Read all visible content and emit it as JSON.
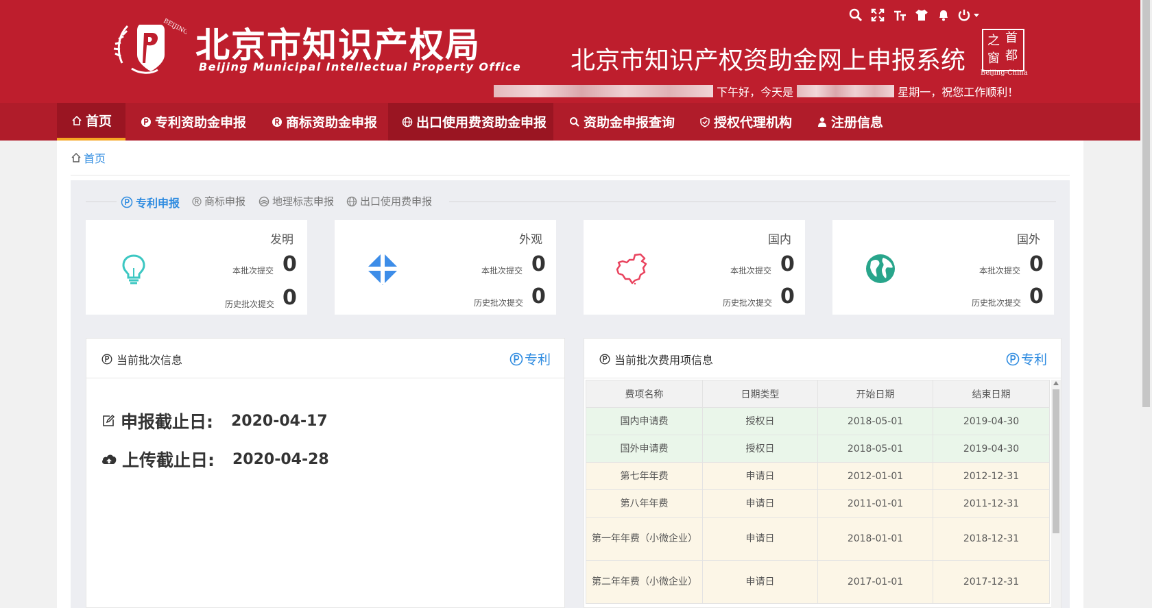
{
  "header": {
    "org_cn": "北京市知识产权局",
    "org_en": "Beijing Municipal Intellectual Property Office",
    "seal_text": "BEIJING INTELLECTUAL PROPERTY",
    "system_title": "北京市知识产权资助金网上申报系统",
    "badge_chars": [
      "之",
      "首",
      "窗",
      "都"
    ],
    "badge_en": "Beijing-China",
    "greeting_1": "下午好，今天是",
    "greeting_2": "星期一，祝您工作顺利！",
    "icons": [
      "search-icon",
      "fullscreen-icon",
      "font-size-icon",
      "theme-shirt-icon",
      "notification-bell-icon",
      "power-icon"
    ],
    "colors": {
      "brand_red": "#be1e2d",
      "nav_red": "#b01c2a",
      "nav_active": "#9a1522",
      "accent_orange": "#f5a623",
      "link_blue": "#2e8be0"
    }
  },
  "nav": {
    "items": [
      {
        "label": "首页",
        "icon": "home-icon"
      },
      {
        "label": "专利资助金申报",
        "icon": "patent-icon"
      },
      {
        "label": "商标资助金申报",
        "icon": "registered-icon"
      },
      {
        "label": "出口使用费资助金申报",
        "icon": "globe-icon"
      },
      {
        "label": "资助金申报查询",
        "icon": "search-icon"
      },
      {
        "label": "授权代理机构",
        "icon": "shield-icon"
      },
      {
        "label": "注册信息",
        "icon": "user-icon"
      }
    ]
  },
  "breadcrumb": {
    "label": "首页"
  },
  "tabs": [
    {
      "label": "专利申报",
      "active": true
    },
    {
      "label": "商标申报",
      "active": false
    },
    {
      "label": "地理标志申报",
      "active": false
    },
    {
      "label": "出口使用费申报",
      "active": false
    }
  ],
  "cards": [
    {
      "title": "发明",
      "icon": "lightbulb-icon",
      "current_label": "本批次提交",
      "current": "0",
      "history_label": "历史批次提交",
      "history": "0",
      "color": "#3cc7c2"
    },
    {
      "title": "外观",
      "icon": "diamond-arrows-icon",
      "current_label": "本批次提交",
      "current": "0",
      "history_label": "历史批次提交",
      "history": "0",
      "color": "#3d8de8"
    },
    {
      "title": "国内",
      "icon": "china-map-icon",
      "current_label": "本批次提交",
      "current": "0",
      "history_label": "历史批次提交",
      "history": "0",
      "color": "#e9435e"
    },
    {
      "title": "国外",
      "icon": "earth-globe-icon",
      "current_label": "本批次提交",
      "current": "0",
      "history_label": "历史批次提交",
      "history": "0",
      "color": "#28a58b"
    }
  ],
  "batch_info": {
    "title": "当前批次信息",
    "link": "专利",
    "deadlines": [
      {
        "label": "申报截止日:",
        "value": "2020-04-17",
        "icon": "edit-icon"
      },
      {
        "label": "上传截止日:",
        "value": "2020-04-28",
        "icon": "cloud-upload-icon"
      }
    ]
  },
  "fee_info": {
    "title": "当前批次费用项信息",
    "link": "专利",
    "columns": [
      "费项名称",
      "日期类型",
      "开始日期",
      "结束日期"
    ],
    "rows": [
      [
        "国内申请费",
        "授权日",
        "2018-05-01",
        "2019-04-30"
      ],
      [
        "国外申请费",
        "授权日",
        "2018-05-01",
        "2019-04-30"
      ],
      [
        "第七年年费",
        "申请日",
        "2012-01-01",
        "2012-12-31"
      ],
      [
        "第八年年费",
        "申请日",
        "2011-01-01",
        "2011-12-31"
      ],
      [
        "第一年年费（小微企业）",
        "申请日",
        "2018-01-01",
        "2018-12-31"
      ],
      [
        "第二年年费（小微企业）",
        "申请日",
        "2017-01-01",
        "2017-12-31"
      ]
    ]
  }
}
